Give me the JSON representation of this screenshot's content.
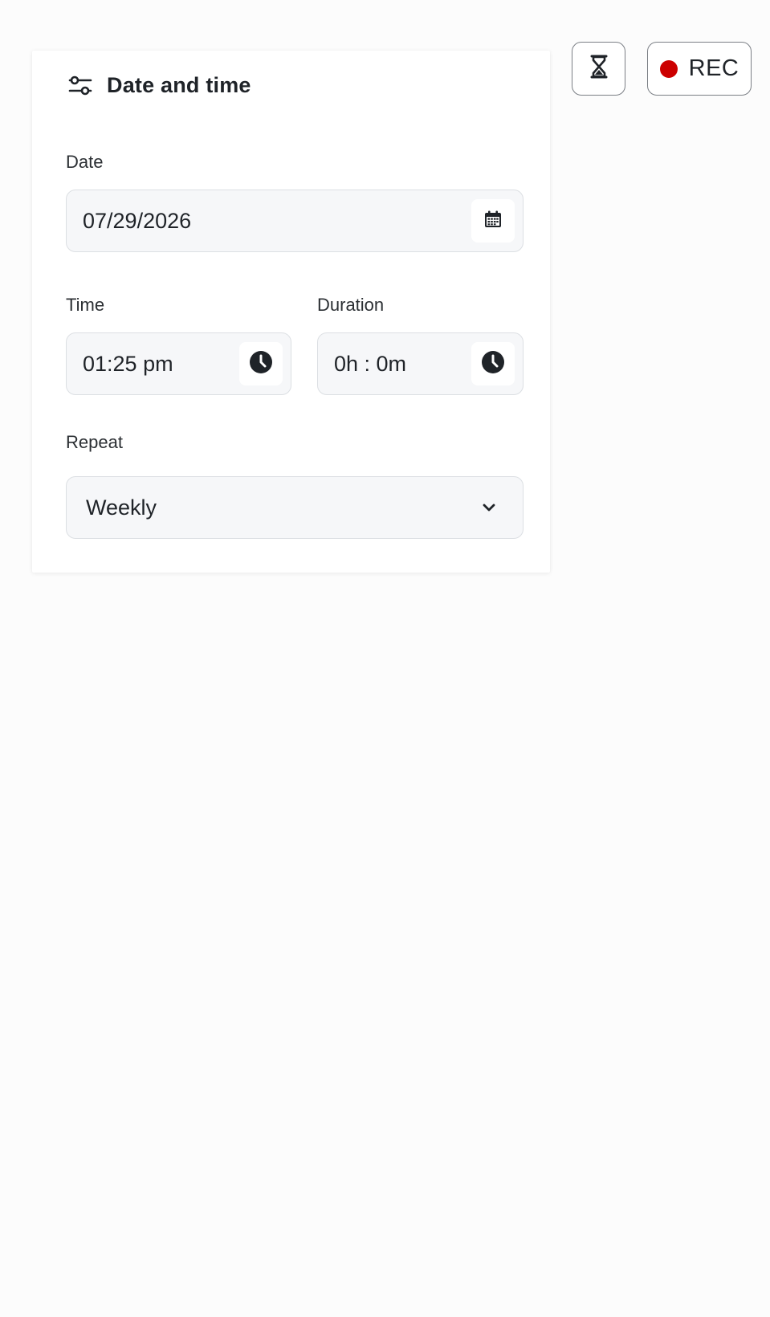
{
  "panel": {
    "title": "Date and time",
    "title_icon": "sliders-icon"
  },
  "date": {
    "label": "Date",
    "value": "07/29/2026",
    "icon": "calendar-icon"
  },
  "time": {
    "label": "Time",
    "value": "01:25 pm",
    "icon": "clock-icon"
  },
  "duration": {
    "label": "Duration",
    "value": "0h : 0m",
    "icon": "clock-icon"
  },
  "repeat": {
    "label": "Repeat",
    "selected": "Weekly",
    "icon": "chevron-down-icon"
  },
  "toolbar": {
    "timer_icon": "hourglass-icon",
    "rec_label": "REC",
    "rec_color": "#cc0000"
  }
}
